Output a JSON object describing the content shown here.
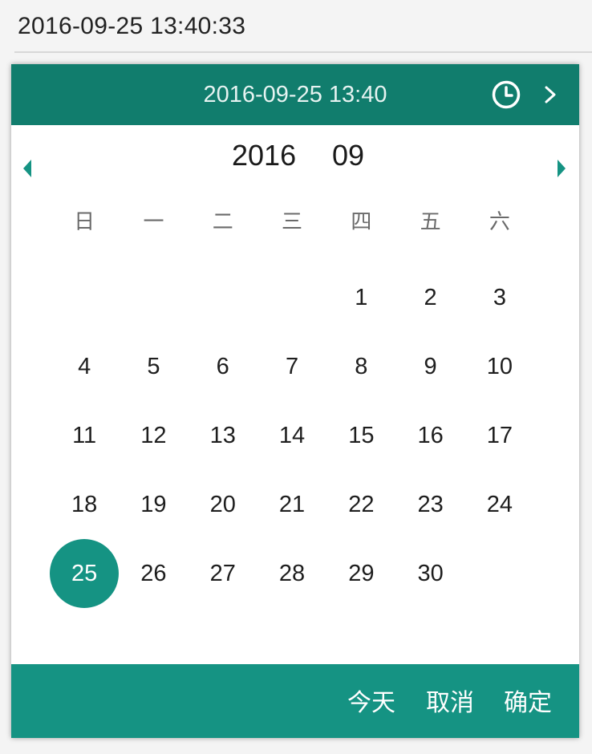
{
  "input": {
    "value": "2016-09-25 13:40:33"
  },
  "header": {
    "datetime": "2016-09-25 13:40",
    "clock_icon": "clock-icon",
    "next_icon": "chevron-right-icon"
  },
  "calendar": {
    "year": "2016",
    "month": "09",
    "prev_icon": "triangle-left-icon",
    "next_icon": "triangle-right-icon",
    "weekdays": [
      "日",
      "一",
      "二",
      "三",
      "四",
      "五",
      "六"
    ],
    "leading_blanks": 4,
    "days": [
      "1",
      "2",
      "3",
      "4",
      "5",
      "6",
      "7",
      "8",
      "9",
      "10",
      "11",
      "12",
      "13",
      "14",
      "15",
      "16",
      "17",
      "18",
      "19",
      "20",
      "21",
      "22",
      "23",
      "24",
      "25",
      "26",
      "27",
      "28",
      "29",
      "30"
    ],
    "selected_day": "25"
  },
  "footer": {
    "today_label": "今天",
    "cancel_label": "取消",
    "confirm_label": "确定"
  },
  "colors": {
    "header_bg": "#117d6d",
    "accent": "#159383",
    "footer_bg": "#159383"
  }
}
